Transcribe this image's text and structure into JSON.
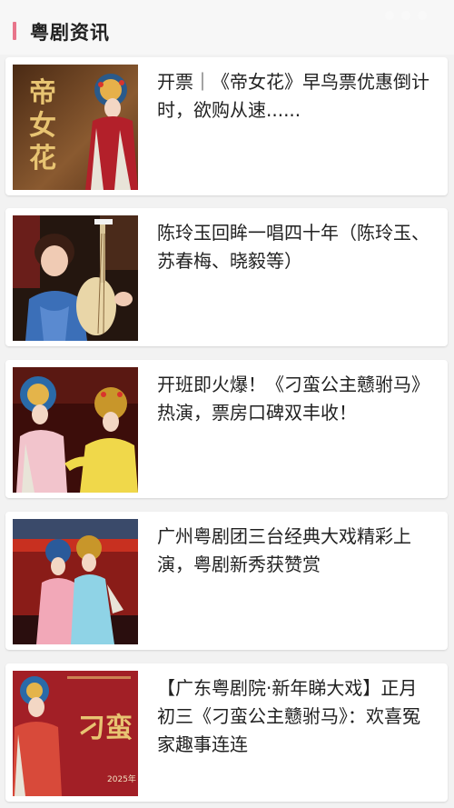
{
  "header": {
    "title": "粤剧资讯"
  },
  "articles": [
    {
      "headline": "开票｜《帝女花》早鸟票优惠倒计时，欲购从速......",
      "thumb_text": "帝女花"
    },
    {
      "headline": "陈玲玉回眸一唱四十年（陈玲玉、苏春梅、晓毅等）"
    },
    {
      "headline": "开班即火爆！《刁蛮公主戆驸马》热演，票房口碑双丰收！"
    },
    {
      "headline": "广州粤剧团三台经典大戏精彩上演，粤剧新秀获赞赏"
    },
    {
      "headline": "【广东粤剧院·新年睇大戏】正月初三《刁蛮公主戆驸马》：欢喜冤家趣事连连",
      "thumb_text": "刁蛮",
      "thumb_date": "2025年"
    }
  ]
}
